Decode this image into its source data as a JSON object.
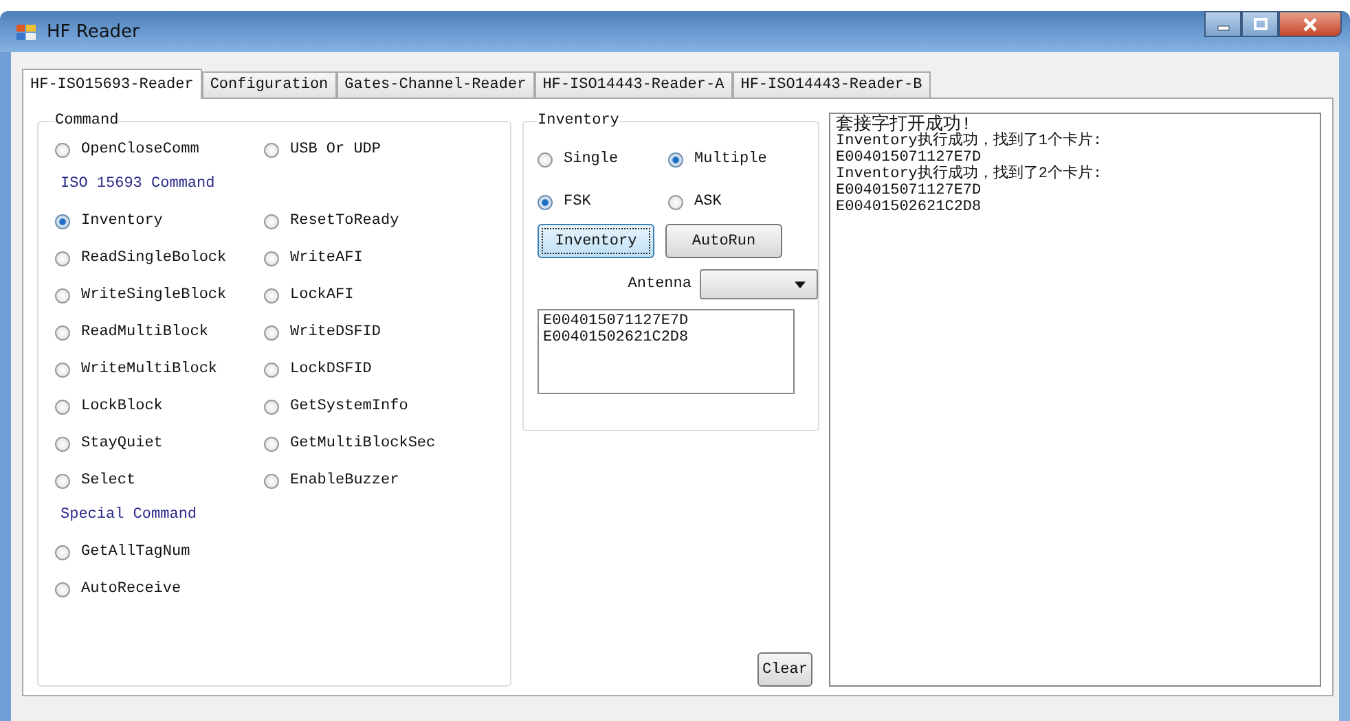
{
  "window": {
    "title": "HF Reader"
  },
  "tabs": [
    {
      "label": "HF-ISO15693-Reader",
      "selected": true
    },
    {
      "label": "Configuration",
      "selected": false
    },
    {
      "label": "Gates-Channel-Reader",
      "selected": false
    },
    {
      "label": "HF-ISO14443-Reader-A",
      "selected": false
    },
    {
      "label": "HF-ISO14443-Reader-B",
      "selected": false
    }
  ],
  "command": {
    "title": "Command",
    "sections": [
      {
        "options": [
          {
            "label": "OpenCloseComm",
            "selected": false
          },
          {
            "label": "USB Or UDP",
            "selected": false
          }
        ]
      },
      {
        "heading": "ISO 15693 Command",
        "options": [
          {
            "label": "Inventory",
            "selected": true
          },
          {
            "label": "ResetToReady",
            "selected": false
          },
          {
            "label": "ReadSingleBolock",
            "selected": false
          },
          {
            "label": "WriteAFI",
            "selected": false
          },
          {
            "label": "WriteSingleBlock",
            "selected": false
          },
          {
            "label": "LockAFI",
            "selected": false
          },
          {
            "label": "ReadMultiBlock",
            "selected": false
          },
          {
            "label": "WriteDSFID",
            "selected": false
          },
          {
            "label": "WriteMultiBlock",
            "selected": false
          },
          {
            "label": "LockDSFID",
            "selected": false
          },
          {
            "label": "LockBlock",
            "selected": false
          },
          {
            "label": "GetSystemInfo",
            "selected": false
          },
          {
            "label": "StayQuiet",
            "selected": false
          },
          {
            "label": "GetMultiBlockSec",
            "selected": false
          },
          {
            "label": "Select",
            "selected": false
          },
          {
            "label": "EnableBuzzer",
            "selected": false
          }
        ]
      },
      {
        "heading": "Special Command",
        "options": [
          {
            "label": "GetAllTagNum",
            "selected": false
          },
          {
            "label": "AutoReceive",
            "selected": false
          }
        ]
      }
    ]
  },
  "inventory": {
    "title": "Inventory",
    "mode_options": [
      {
        "label": "Single",
        "selected": false
      },
      {
        "label": "Multiple",
        "selected": true
      }
    ],
    "modulation_options": [
      {
        "label": "FSK",
        "selected": true
      },
      {
        "label": "ASK",
        "selected": false
      }
    ],
    "buttons": [
      {
        "label": "Inventory",
        "focused": true
      },
      {
        "label": "AutoRun",
        "focused": false
      }
    ],
    "antenna_label": "Antenna",
    "tags": [
      "E004015071127E7D",
      "E00401502621C2D8"
    ]
  },
  "clear_button": "Clear",
  "log": [
    "套接字打开成功!",
    "Inventory执行成功，找到了1个卡片:",
    "E004015071127E7D",
    "Inventory执行成功，找到了2个卡片:",
    "E004015071127E7D",
    "E00401502621C2D8"
  ]
}
